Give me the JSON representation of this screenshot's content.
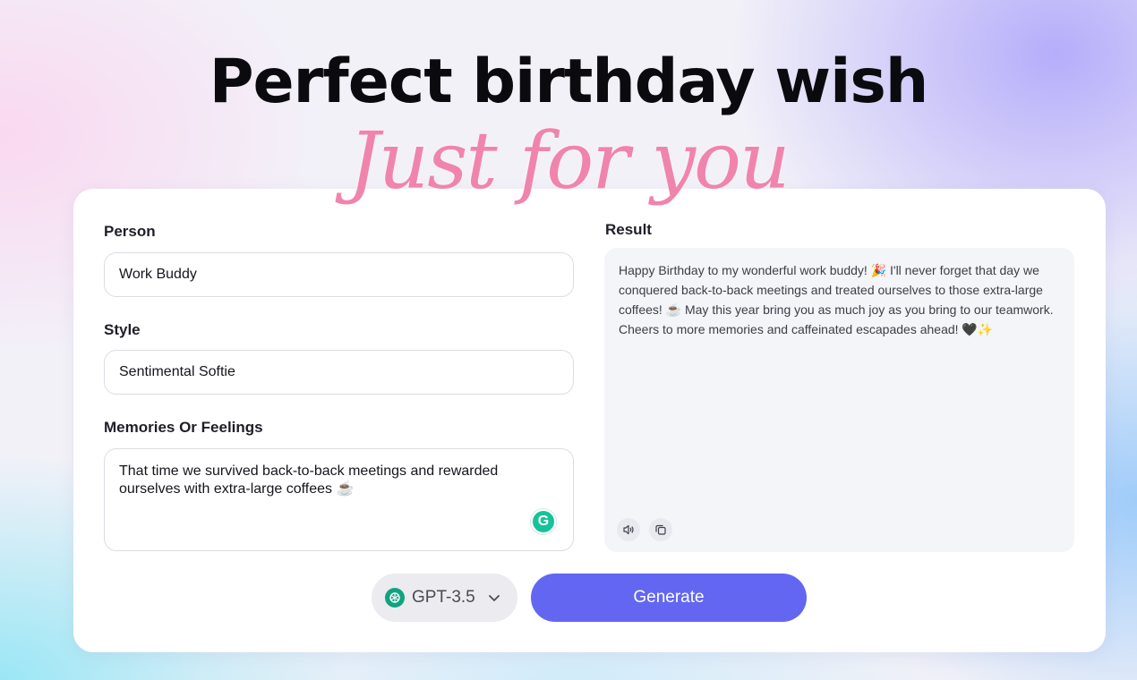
{
  "hero": {
    "headline": "Perfect birthday wish",
    "script": "Just for you"
  },
  "form": {
    "person": {
      "label": "Person",
      "value": "Work Buddy"
    },
    "style": {
      "label": "Style",
      "value": "Sentimental Softie"
    },
    "memories": {
      "label": "Memories Or Feelings",
      "value": "That time we survived back-to-back meetings and rewarded ourselves with extra-large coffees ☕"
    }
  },
  "result": {
    "label": "Result",
    "text": "Happy Birthday to my wonderful work buddy! 🎉 I'll never forget that day we conquered back-to-back meetings and treated ourselves to those extra-large coffees! ☕ May this year bring you as much joy as you bring to our teamwork. Cheers to more memories and caffeinated escapades ahead! 🖤✨"
  },
  "actions": {
    "model": "GPT-3.5",
    "generate_label": "Generate"
  },
  "icons": {
    "grammarly": "grammarly-icon",
    "speaker": "speaker-icon",
    "copy": "copy-icon",
    "gpt": "openai-logo-icon",
    "chevron": "chevron-down-icon"
  },
  "colors": {
    "accent": "#6366f1",
    "script_pink": "#f084ad",
    "grammarly_green": "#15c39a",
    "openai_green": "#10a37f"
  }
}
